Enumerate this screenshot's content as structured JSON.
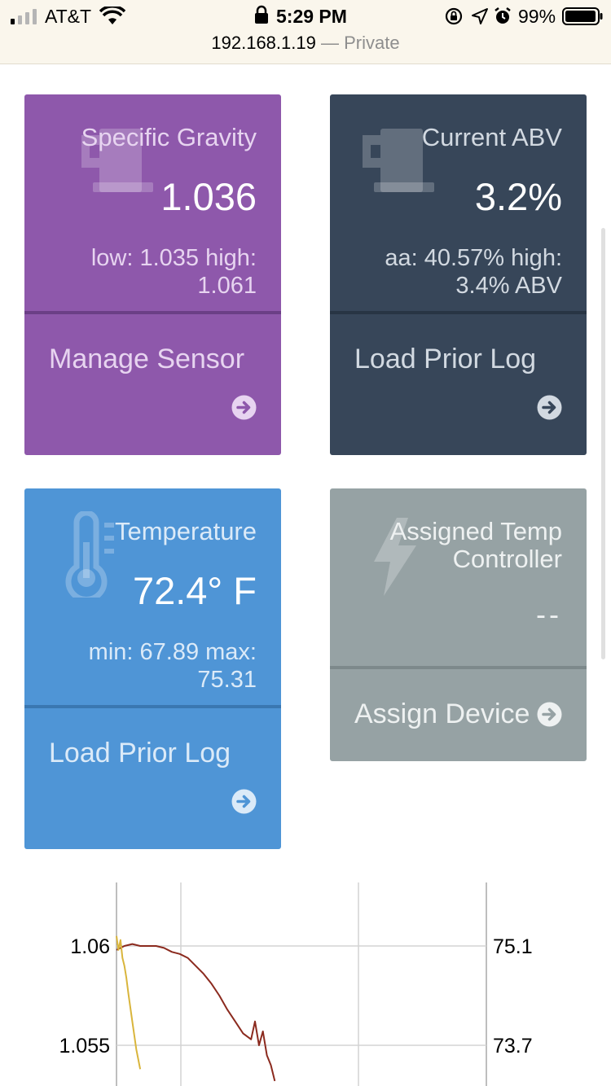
{
  "status_bar": {
    "carrier": "AT&T",
    "time": "5:29 PM",
    "battery": "99%"
  },
  "url_bar": {
    "host": "192.168.1.19",
    "separator": "—",
    "mode": "Private"
  },
  "tiles": [
    {
      "label": "Specific Gravity",
      "value": "1.036",
      "sub": "low: 1.035 high: 1.061",
      "footer": "Manage Sensor",
      "icon": "beer-mug-icon"
    },
    {
      "label": "Current ABV",
      "value": "3.2%",
      "sub": "aa: 40.57% high: 3.4% ABV",
      "footer": "Load Prior Log",
      "icon": "beer-mug-icon"
    },
    {
      "label": "Temperature",
      "value": "72.4° F",
      "sub": "min: 67.89 max: 75.31",
      "footer": "Load Prior Log",
      "icon": "thermometer-icon"
    },
    {
      "label": "Assigned Temp Controller",
      "value": "--",
      "footer": "Assign Device",
      "icon": "lightning-icon"
    }
  ],
  "colors": {
    "purple": "#8e58ab",
    "navy": "#374659",
    "blue": "#4f95d6",
    "gray": "#96a2a4",
    "gravity_line": "#8b2a1e",
    "temp_line": "#d9b53c"
  },
  "chart_data": {
    "type": "line",
    "left_ticks": [
      "1.06",
      "1.055"
    ],
    "right_ticks": [
      "75.1",
      "73.7"
    ],
    "series": [
      {
        "color": "#8b2a1e",
        "x": [
          0,
          2,
          4,
          6,
          8,
          10,
          12,
          14,
          16,
          18,
          20,
          22,
          24,
          26,
          28,
          30,
          32,
          34,
          35,
          36,
          37,
          38,
          39,
          40
        ],
        "y": [
          1.0598,
          1.06,
          1.0601,
          1.06,
          1.06,
          1.06,
          1.0599,
          1.0597,
          1.0596,
          1.0594,
          1.059,
          1.0586,
          1.0581,
          1.0575,
          1.0568,
          1.0562,
          1.0556,
          1.0553,
          1.0562,
          1.055,
          1.0557,
          1.0545,
          1.054,
          1.0532
        ]
      },
      {
        "color": "#d9b53c",
        "x": [
          0,
          0.5,
          1,
          1.5,
          2,
          2.5,
          3,
          4,
          5,
          6
        ],
        "y": [
          1.0605,
          1.0598,
          1.0603,
          1.0594,
          1.059,
          1.0584,
          1.0576,
          1.0562,
          1.0548,
          1.0538
        ]
      }
    ],
    "ylim": [
      1.0535,
      1.0625
    ],
    "xlim": [
      0,
      100
    ]
  }
}
